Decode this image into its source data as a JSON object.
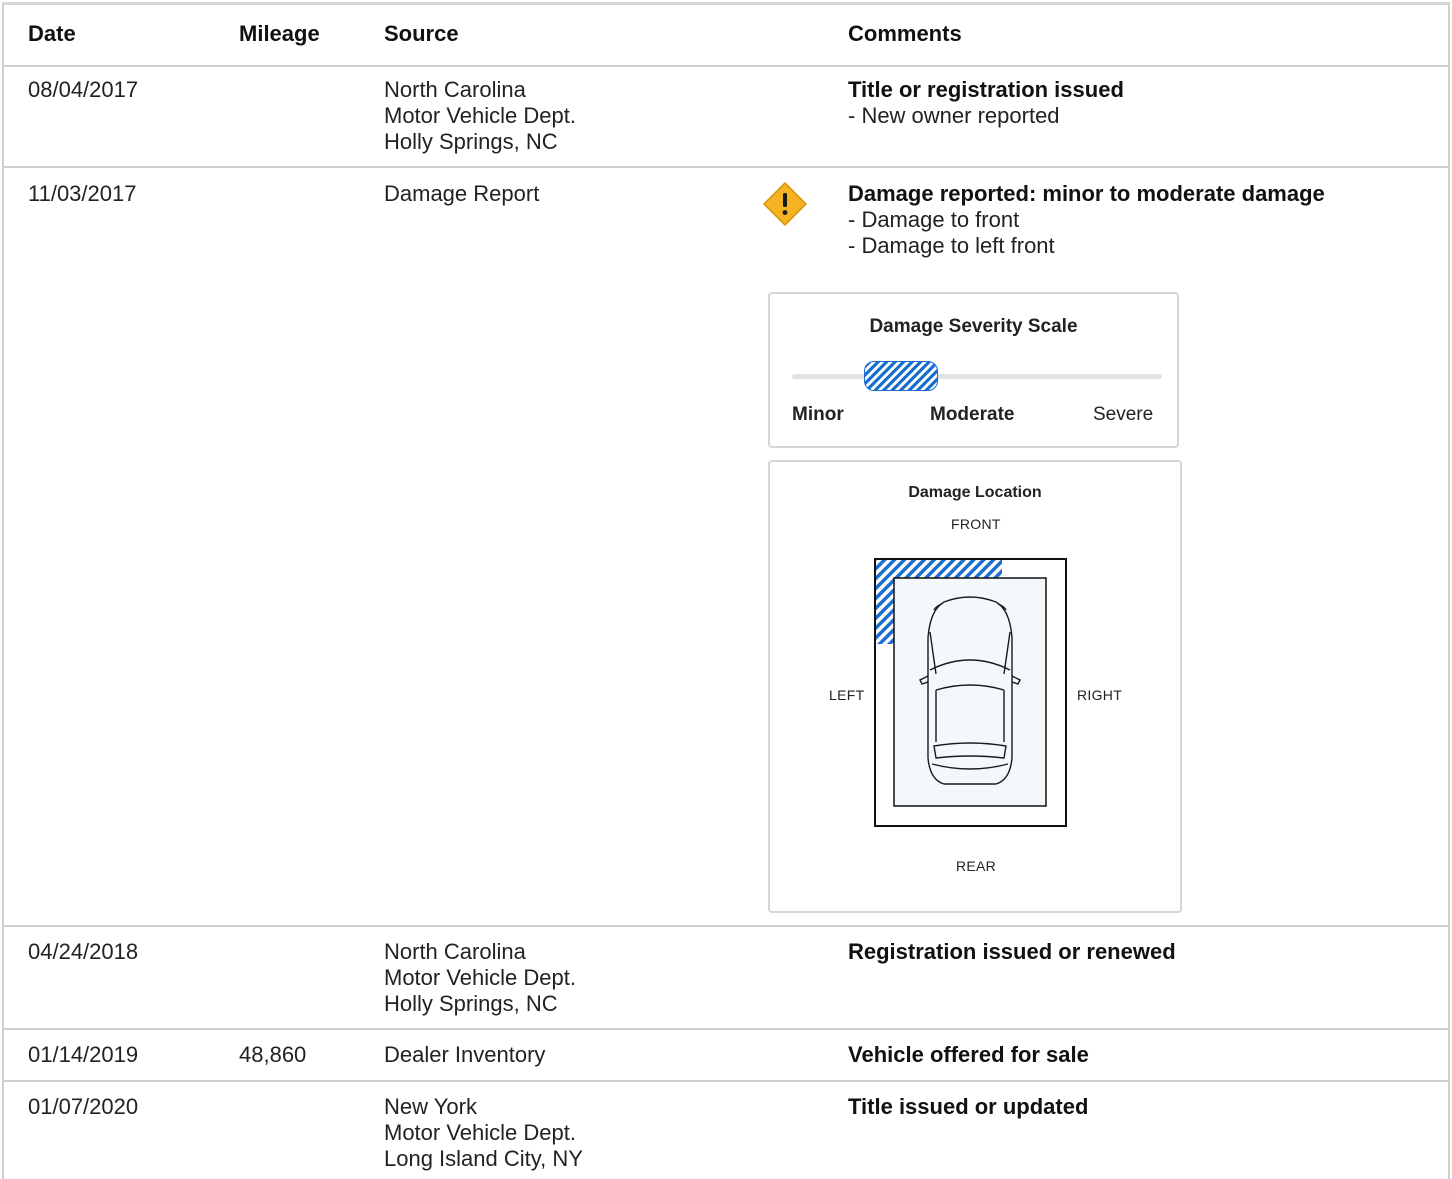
{
  "table": {
    "headers": {
      "date": "Date",
      "mileage": "Mileage",
      "source": "Source",
      "comments": "Comments"
    },
    "rows": [
      {
        "date": "08/04/2017",
        "mileage": "",
        "source": [
          "North Carolina",
          "Motor Vehicle Dept.",
          "Holly Springs, NC"
        ],
        "title": "Title or registration issued",
        "notes": [
          "- New owner reported"
        ]
      },
      {
        "date": "11/03/2017",
        "mileage": "",
        "source": [
          "Damage Report"
        ],
        "title": "Damage reported: minor to moderate damage",
        "notes": [
          "- Damage to front",
          "- Damage to left front"
        ]
      },
      {
        "date": "04/24/2018",
        "mileage": "",
        "source": [
          "North Carolina",
          "Motor Vehicle Dept.",
          "Holly Springs, NC"
        ],
        "title": "Registration issued or renewed",
        "notes": []
      },
      {
        "date": "01/14/2019",
        "mileage": "48,860",
        "source": [
          "Dealer Inventory"
        ],
        "title": "Vehicle offered for sale",
        "notes": []
      },
      {
        "date": "01/07/2020",
        "mileage": "",
        "source": [
          "New York",
          "Motor Vehicle Dept.",
          "Long Island City, NY"
        ],
        "title": "Title issued or updated",
        "notes": []
      }
    ]
  },
  "severity": {
    "title": "Damage Severity Scale",
    "labels": {
      "minor": "Minor",
      "moderate": "Moderate",
      "severe": "Severe"
    },
    "active": [
      "Minor",
      "Moderate"
    ]
  },
  "location": {
    "title": "Damage Location",
    "front": "FRONT",
    "rear": "REAR",
    "left": "LEFT",
    "right": "RIGHT",
    "damaged_zones": [
      "front",
      "left-front"
    ]
  },
  "colors": {
    "damage_hatch": "#1a6fd0",
    "warning": "#f5b324",
    "divider": "#cfcfcf"
  },
  "icons": {
    "warning": "warning-diamond-icon"
  }
}
